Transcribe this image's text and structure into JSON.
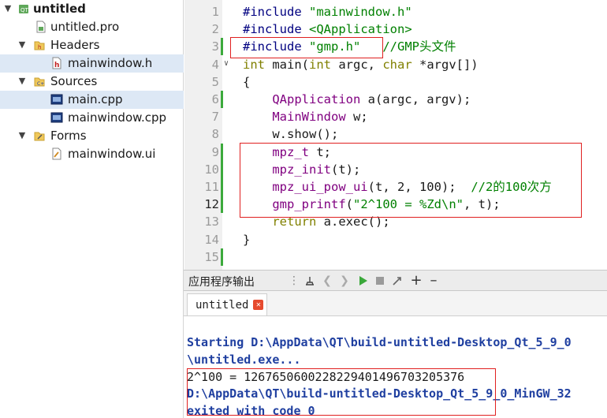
{
  "project_tree": {
    "root": "untitled",
    "pro_file": "untitled.pro",
    "headers_label": "Headers",
    "header_file": "mainwindow.h",
    "sources_label": "Sources",
    "source_main": "main.cpp",
    "source_window": "mainwindow.cpp",
    "forms_label": "Forms",
    "form_file": "mainwindow.ui"
  },
  "editor": {
    "line_numbers": [
      "1",
      "2",
      "3",
      "4",
      "5",
      "6",
      "7",
      "8",
      "9",
      "10",
      "11",
      "12",
      "13",
      "14",
      "15"
    ],
    "current_line": 12,
    "lines": [
      [
        {
          "t": "#include ",
          "c": "pp"
        },
        {
          "t": "\"mainwindow.h\"",
          "c": "str"
        }
      ],
      [
        {
          "t": "#include ",
          "c": "pp"
        },
        {
          "t": "<QApplication>",
          "c": "str"
        }
      ],
      [
        {
          "t": "#include ",
          "c": "pp"
        },
        {
          "t": "\"gmp.h\"",
          "c": "str"
        },
        {
          "t": "   ",
          "c": ""
        },
        {
          "t": "//GMP头文件",
          "c": "cmt"
        }
      ],
      [
        {
          "t": "int",
          "c": "kw"
        },
        {
          "t": " main(",
          "c": ""
        },
        {
          "t": "int",
          "c": "kw"
        },
        {
          "t": " argc, ",
          "c": ""
        },
        {
          "t": "char",
          "c": "kw"
        },
        {
          "t": " *argv[])",
          "c": ""
        }
      ],
      [
        {
          "t": "{",
          "c": ""
        }
      ],
      [
        {
          "t": "    ",
          "c": ""
        },
        {
          "t": "QApplication",
          "c": "ty"
        },
        {
          "t": " a(argc, argv);",
          "c": ""
        }
      ],
      [
        {
          "t": "    ",
          "c": ""
        },
        {
          "t": "MainWindow",
          "c": "ty"
        },
        {
          "t": " w;",
          "c": ""
        }
      ],
      [
        {
          "t": "    w.show();",
          "c": ""
        }
      ],
      [
        {
          "t": "    ",
          "c": ""
        },
        {
          "t": "mpz_t",
          "c": "ty"
        },
        {
          "t": " t;",
          "c": ""
        }
      ],
      [
        {
          "t": "    ",
          "c": ""
        },
        {
          "t": "mpz_init",
          "c": "ty"
        },
        {
          "t": "(t);",
          "c": ""
        }
      ],
      [
        {
          "t": "    ",
          "c": ""
        },
        {
          "t": "mpz_ui_pow_ui",
          "c": "ty"
        },
        {
          "t": "(t, 2, 100);  ",
          "c": ""
        },
        {
          "t": "//2的100次方",
          "c": "cmt"
        }
      ],
      [
        {
          "t": "    ",
          "c": ""
        },
        {
          "t": "gmp_printf",
          "c": "ty"
        },
        {
          "t": "(",
          "c": ""
        },
        {
          "t": "\"2^100 = %Zd\\n\"",
          "c": "str"
        },
        {
          "t": ", t);",
          "c": ""
        }
      ],
      [
        {
          "t": "    ",
          "c": ""
        },
        {
          "t": "return",
          "c": "kw"
        },
        {
          "t": " a.exec();",
          "c": ""
        }
      ],
      [
        {
          "t": "}",
          "c": ""
        }
      ],
      [
        {
          "t": "",
          "c": ""
        }
      ]
    ]
  },
  "output": {
    "panel_title": "应用程序输出",
    "tab_label": "untitled",
    "line1": "Starting D:\\AppData\\QT\\build-untitled-Desktop_Qt_5_9_0",
    "line2": "\\untitled.exe...",
    "line3": "2^100 = 1267650600228229401496703205376",
    "line4": "D:\\AppData\\QT\\build-untitled-Desktop_Qt_5_9_0_MinGW_32",
    "line5": "exited with code 0"
  }
}
